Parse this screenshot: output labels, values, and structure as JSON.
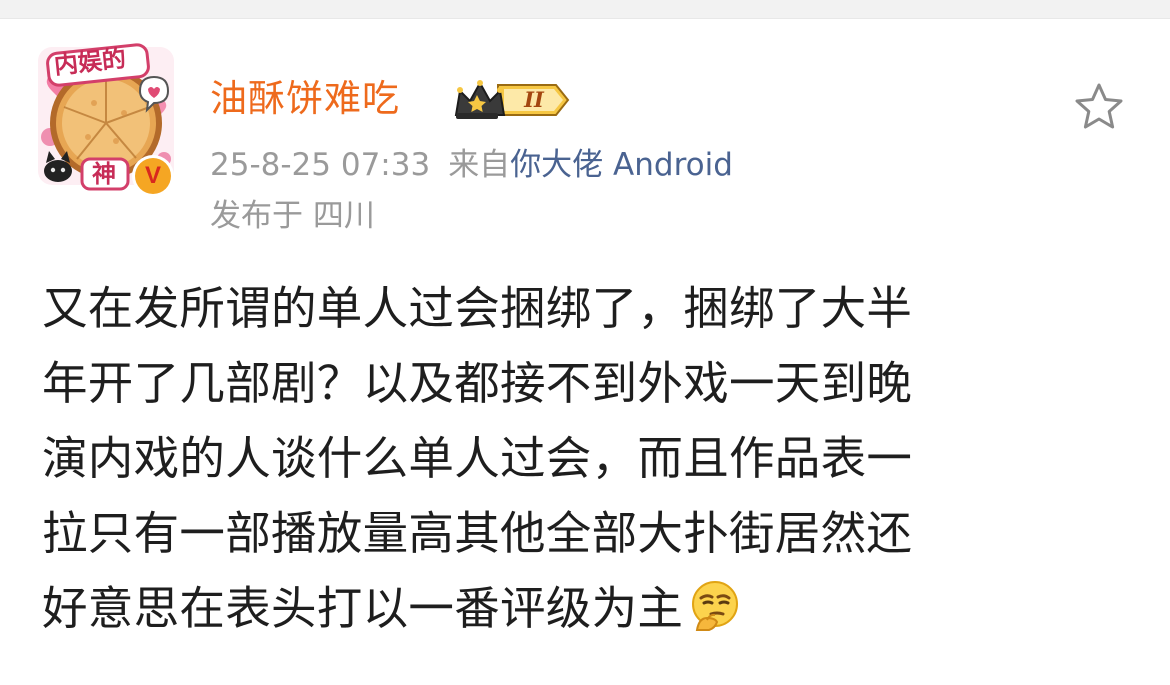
{
  "post": {
    "avatar": {
      "frame_top_text": "内娱的",
      "frame_bottom_text": "神"
    },
    "verified_badge_symbol": "V",
    "username": "油酥饼难吃",
    "level_badge": "II",
    "meta": {
      "time": "25-8-25 07:33",
      "from_label": "来自",
      "client": "你大佬 Android",
      "location": "发布于 四川"
    },
    "content_lines": [
      "又在发所谓的单人过会捆绑了，捆绑了大半",
      "年开了几部剧？以及都接不到外戏一天到晚",
      "演内戏的人谈什么单人过会，而且作品表一",
      "拉只有一部播放量高其他全部大扑街居然还",
      "好意思在表头打以一番评级为主"
    ],
    "trailing_emoji": "thinking-face-emoji",
    "icons": {
      "favorite": "star-outline-icon",
      "verified": "verified-v-icon",
      "level": "crown-icon"
    },
    "colors": {
      "username": "#ee6a1c",
      "client_link": "#4a6391",
      "meta_gray": "#9a9a9a",
      "verified": "#f5a623"
    }
  }
}
